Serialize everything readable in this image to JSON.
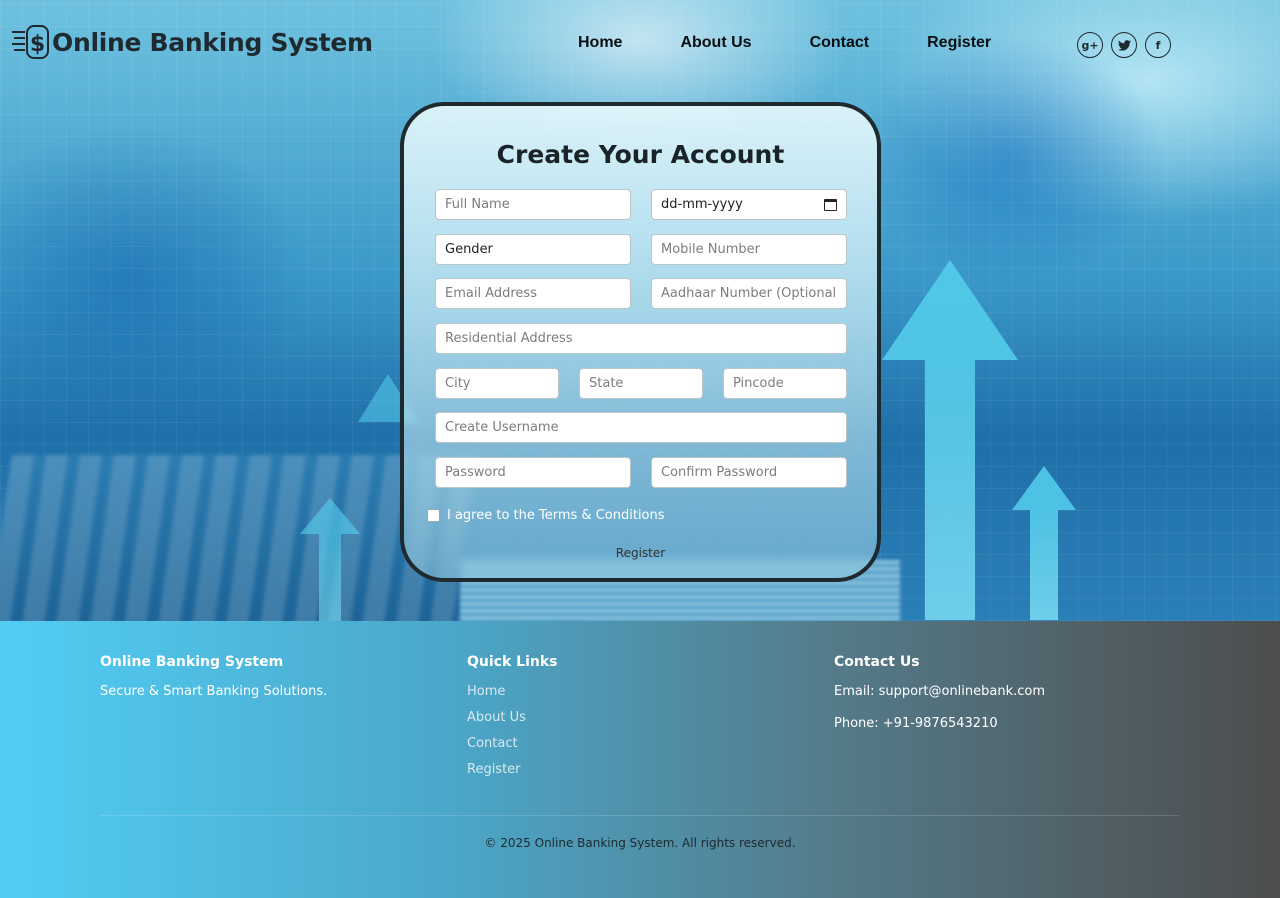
{
  "header": {
    "site_title": "Online Banking System",
    "nav": [
      "Home",
      "About Us",
      "Contact",
      "Register"
    ],
    "social": [
      {
        "icon": "google-plus-icon",
        "glyph": "g+"
      },
      {
        "icon": "twitter-icon",
        "glyph": "t"
      },
      {
        "icon": "facebook-icon",
        "glyph": "f"
      }
    ]
  },
  "form": {
    "title": "Create Your Account",
    "full_name_placeholder": "Full Name",
    "dob_value": "dd-mm-yyyy",
    "gender_value": "Gender",
    "mobile_placeholder": "Mobile Number",
    "email_placeholder": "Email Address",
    "aadhaar_placeholder": "Aadhaar Number (Optional)",
    "address_placeholder": "Residential Address",
    "city_placeholder": "City",
    "state_placeholder": "State",
    "pincode_placeholder": "Pincode",
    "username_placeholder": "Create Username",
    "password_placeholder": "Password",
    "confirm_password_placeholder": "Confirm Password",
    "terms_label": "I agree to the Terms & Conditions",
    "register_label": "Register"
  },
  "footer": {
    "brand_title": "Online Banking System",
    "brand_tagline": "Secure & Smart Banking Solutions.",
    "quick_links_title": "Quick Links",
    "quick_links": [
      "Home",
      "About Us",
      "Contact",
      "Register"
    ],
    "contact_title": "Contact Us",
    "email": "Email: support@onlinebank.com",
    "phone": "Phone: +91-9876543210",
    "copyright": "© 2025 Online Banking System. All rights reserved."
  },
  "colors": {
    "card_border": "#1f2a2f",
    "footer_start": "#52cdf5",
    "footer_end": "#4d4d4d",
    "arrow": "#56d0ee"
  }
}
